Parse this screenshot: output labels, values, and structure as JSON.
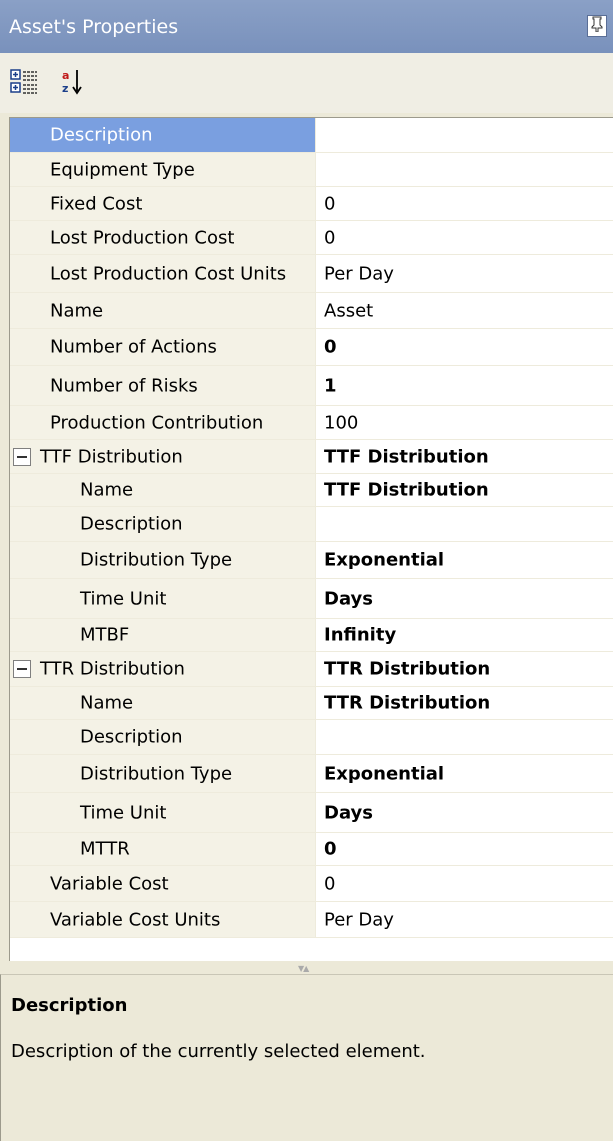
{
  "panel": {
    "title": "Asset's Properties",
    "pin_glyph": "P"
  },
  "toolbar": {
    "categorized_icon": "categorized-icon",
    "alphabetical_icon": "sort-az-icon"
  },
  "properties": [
    {
      "name": "Description",
      "value": "",
      "selected": true
    },
    {
      "name": "Equipment Type",
      "value": ""
    },
    {
      "name": "Fixed Cost",
      "value": "0"
    },
    {
      "name": "Lost Production Cost",
      "value": "0"
    },
    {
      "name": "Lost Production Cost Units",
      "value": "Per Day"
    },
    {
      "name": "Name",
      "value": "Asset"
    },
    {
      "name": "Number of Actions",
      "value": "0",
      "bold": true
    },
    {
      "name": "Number of Risks",
      "value": "1",
      "bold": true
    },
    {
      "name": "Production Contribution",
      "value": "100"
    },
    {
      "name": "TTF Distribution",
      "value": "TTF Distribution",
      "bold": true,
      "expandable": true
    },
    {
      "name": "Name",
      "value": "TTF Distribution",
      "bold": true,
      "child": true
    },
    {
      "name": "Description",
      "value": "",
      "child": true
    },
    {
      "name": "Distribution Type",
      "value": "Exponential",
      "bold": true,
      "child": true
    },
    {
      "name": "Time Unit",
      "value": "Days",
      "bold": true,
      "child": true
    },
    {
      "name": "MTBF",
      "value": "Infinity",
      "bold": true,
      "child": true
    },
    {
      "name": "TTR Distribution",
      "value": "TTR Distribution",
      "bold": true,
      "expandable": true
    },
    {
      "name": "Name",
      "value": "TTR Distribution",
      "bold": true,
      "child": true
    },
    {
      "name": "Description",
      "value": "",
      "child": true
    },
    {
      "name": "Distribution Type",
      "value": "Exponential",
      "bold": true,
      "child": true
    },
    {
      "name": "Time Unit",
      "value": "Days",
      "bold": true,
      "child": true
    },
    {
      "name": "MTTR",
      "value": "0",
      "bold": true,
      "child": true
    },
    {
      "name": "Variable Cost",
      "value": "0"
    },
    {
      "name": "Variable Cost Units",
      "value": "Per Day"
    }
  ],
  "description_panel": {
    "title": "Description",
    "text": "Description of the currently selected element."
  }
}
